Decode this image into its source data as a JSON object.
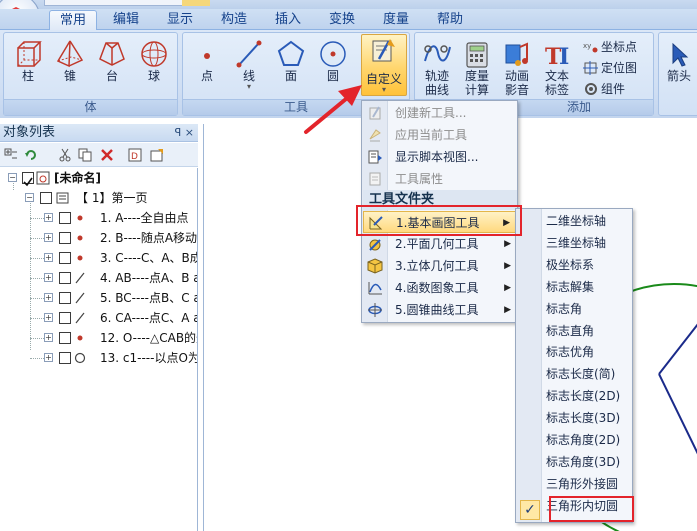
{
  "app_logo": "geometry-app-logo",
  "tabs": [
    "常用",
    "编辑",
    "显示",
    "构造",
    "插入",
    "变换",
    "度量",
    "帮助"
  ],
  "ribbon": {
    "group_solid": {
      "label": "体",
      "buttons": [
        {
          "label": "柱",
          "icon": "prism-icon"
        },
        {
          "label": "锥",
          "icon": "pyramid-icon"
        },
        {
          "label": "台",
          "icon": "frustum-icon"
        },
        {
          "label": "球",
          "icon": "sphere-icon"
        }
      ]
    },
    "group_tools": {
      "label": "工具",
      "buttons": [
        {
          "label": "点",
          "icon": "point-icon"
        },
        {
          "label": "线",
          "icon": "line-icon"
        },
        {
          "label": "面",
          "icon": "polygon-icon"
        },
        {
          "label": "圆",
          "icon": "circle-icon"
        }
      ],
      "custom": {
        "label": "自定义",
        "icon": "custom-tool-icon"
      }
    },
    "group_add": {
      "label": "添加",
      "buttons": [
        {
          "label": "轨迹\n曲线",
          "line1": "轨迹",
          "line2": "曲线",
          "icon": "locus-icon"
        },
        {
          "label": "度量\n计算",
          "line1": "度量",
          "line2": "计算",
          "icon": "calculator-icon"
        },
        {
          "label": "动画\n影音",
          "line1": "动画",
          "line2": "影音",
          "icon": "media-icon"
        },
        {
          "label": "文本\n标签",
          "line1": "文本",
          "line2": "标签",
          "icon": "text-icon"
        }
      ],
      "small": [
        {
          "label": "坐标点",
          "icon": "xy-point-icon"
        },
        {
          "label": "定位图",
          "icon": "locate-icon"
        },
        {
          "label": "组件",
          "icon": "component-icon"
        }
      ]
    },
    "arrow_button": {
      "label": "箭头",
      "icon": "arrow-cursor-icon"
    }
  },
  "object_pane": {
    "title": "对象列表",
    "pin": "ꟼ ×",
    "root": "[未命名]",
    "page": "【 1】第一页",
    "items": [
      {
        "label": "1. A----全自由点",
        "icon": "dot"
      },
      {
        "label": "2. B----随点A移动",
        "icon": "dot"
      },
      {
        "label": "3. C----C、A、B成",
        "icon": "dot"
      },
      {
        "label": "4. AB----点A、B a",
        "icon": "segment"
      },
      {
        "label": "5. BC----点B、C a",
        "icon": "segment"
      },
      {
        "label": "6. CA----点C、A a",
        "icon": "segment"
      },
      {
        "label": "12. O----△CAB的外",
        "icon": "dot"
      },
      {
        "label": "13. c1----以点O为",
        "icon": "circle"
      }
    ]
  },
  "menu_main": {
    "items": [
      {
        "label": "创建新工具...",
        "disabled": true
      },
      {
        "label": "应用当前工具",
        "disabled": true
      },
      {
        "label": "显示脚本视图...",
        "disabled": false
      },
      {
        "label": "工具属性",
        "disabled": true
      }
    ],
    "header": "工具文件夹",
    "folders": [
      {
        "label": "1.基本画图工具",
        "highlighted": true
      },
      {
        "label": "2.平面几何工具",
        "highlighted": false
      },
      {
        "label": "3.立体几何工具",
        "highlighted": false
      },
      {
        "label": "4.函数图象工具",
        "highlighted": false
      },
      {
        "label": "5.圆锥曲线工具",
        "highlighted": false
      }
    ]
  },
  "menu_sub": {
    "items": [
      "二维坐标轴",
      "三维坐标轴",
      "极坐标系",
      "标志解集",
      "标志角",
      "标志直角",
      "标志优角",
      "标志长度(简)",
      "标志长度(2D)",
      "标志长度(3D)",
      "标志角度(2D)",
      "标志角度(3D)",
      "三角形外接圆",
      "三角形内切圆"
    ],
    "checked_index": 13
  },
  "colors": {
    "highlight_red": "#e3242b",
    "menu_highlight": "#ffd97f",
    "ribbon_bg": "#d2e1f5",
    "tab_text": "#15428b"
  }
}
